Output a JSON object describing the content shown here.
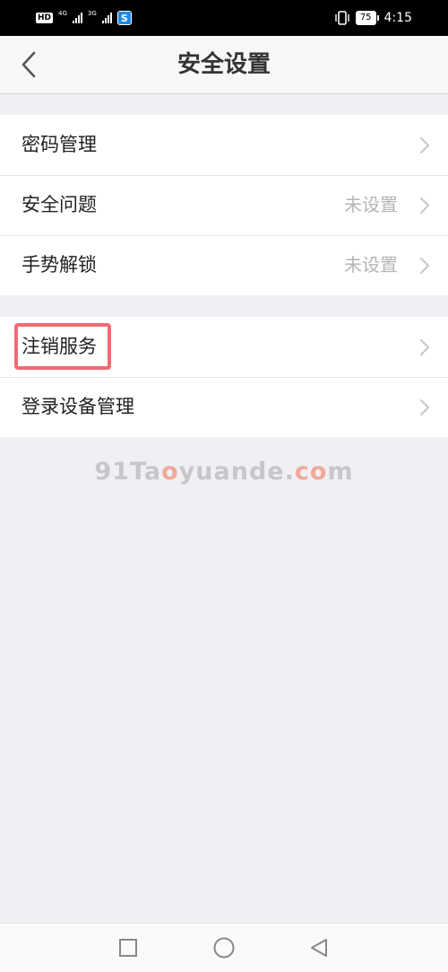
{
  "status_bar": {
    "hd": "HD",
    "net1": "4G",
    "net2": "3G",
    "battery": "75",
    "time": "4:15"
  },
  "header": {
    "title": "安全设置"
  },
  "groups": [
    {
      "items": [
        {
          "label": "密码管理",
          "value": ""
        },
        {
          "label": "安全问题",
          "value": "未设置"
        },
        {
          "label": "手势解锁",
          "value": "未设置"
        }
      ]
    },
    {
      "items": [
        {
          "label": "注销服务",
          "value": ""
        },
        {
          "label": "登录设备管理",
          "value": ""
        }
      ]
    }
  ],
  "watermark": {
    "part1": "91Ta",
    "accent1": "o",
    "part2": "yuande.",
    "accent2": "co",
    "part3": "m"
  },
  "colors": {
    "highlight": "#ef6b74",
    "background": "#efeff4"
  }
}
